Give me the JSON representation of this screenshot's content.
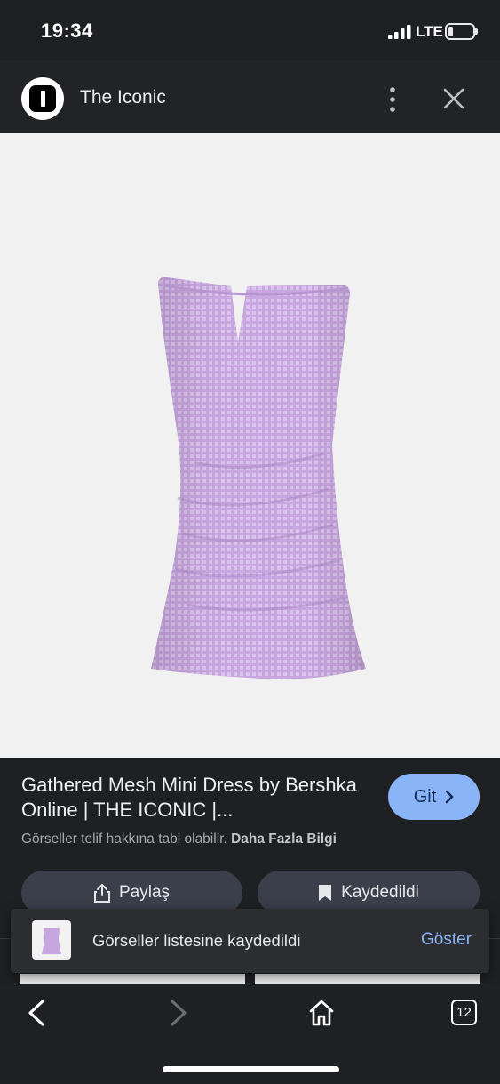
{
  "status_bar": {
    "time": "19:34",
    "network": "LTE",
    "battery_level": 0.2
  },
  "header": {
    "site_name": "The Iconic",
    "more_icon": "more-vertical-icon",
    "close_icon": "close-icon"
  },
  "image": {
    "description_icon": "dress-product-image",
    "dress_color": "#c9a7e0"
  },
  "result": {
    "title": "Gathered Mesh Mini Dress by Bershka Online | THE ICONIC |...",
    "visit_label": "Git",
    "copyright_text": "Görseller telif hakkına tabi olabilir.",
    "more_info_link": "Daha Fazla Bilgi"
  },
  "actions": {
    "share_label": "Paylaş",
    "saved_label": "Kaydedildi"
  },
  "toast": {
    "message": "Görseller listesine kaydedildi",
    "action": "Göster"
  },
  "toolbar": {
    "tabs_count": "12"
  },
  "colors": {
    "accent": "#8ab4f8",
    "background": "#1f2023",
    "pill": "#3a3f4b"
  }
}
